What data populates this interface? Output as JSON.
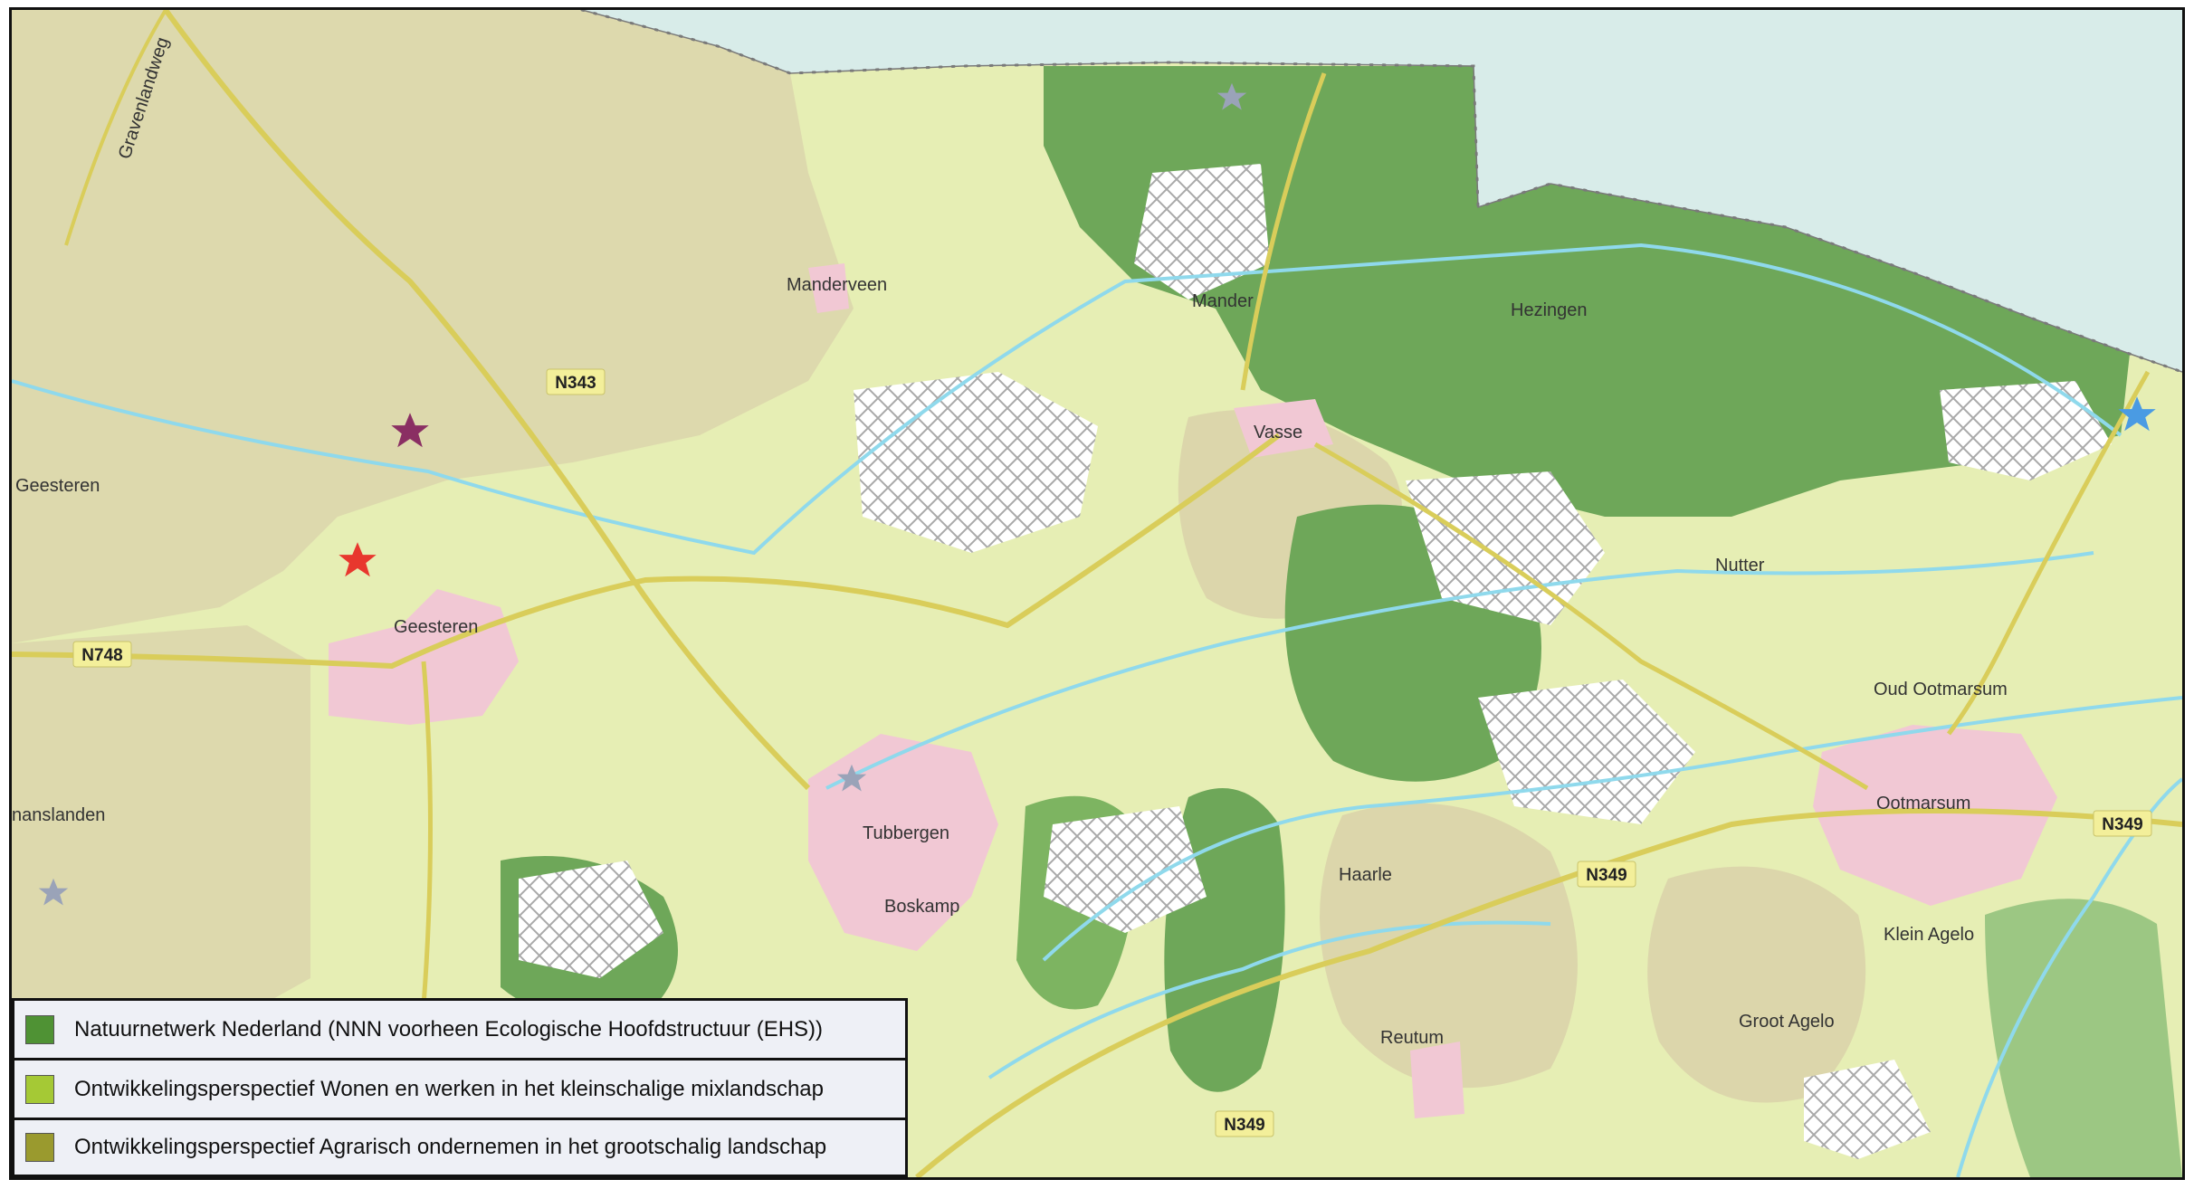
{
  "map": {
    "colors": {
      "water": "#d8ece9",
      "mix_landscape": "#e6eeb4",
      "agrarian": "#ddd9ad",
      "nature": "#6ea759",
      "built_up": "#f1c8d4",
      "stream": "#8fd9ec",
      "road": "#d9cd5a",
      "border": "#7a7a7a"
    },
    "places": [
      {
        "name": "Manderveen"
      },
      {
        "name": "Mander"
      },
      {
        "name": "Hezingen"
      },
      {
        "name": "Geesteren"
      },
      {
        "name": "Geesteren"
      },
      {
        "name": "Vasse"
      },
      {
        "name": "Nutter"
      },
      {
        "name": "Oud Ootmarsum"
      },
      {
        "name": "Ootmarsum"
      },
      {
        "name": "Tubbergen"
      },
      {
        "name": "Boskamp"
      },
      {
        "name": "Haarle"
      },
      {
        "name": "Klein Agelo"
      },
      {
        "name": "Groot Agelo"
      },
      {
        "name": "Reutum"
      },
      {
        "name": "nanslanden"
      },
      {
        "name": "Gravenlandweg"
      }
    ],
    "roads": [
      {
        "label": "N343"
      },
      {
        "label": "N748"
      },
      {
        "label": "N349"
      },
      {
        "label": "N349"
      },
      {
        "label": "N349"
      }
    ],
    "markers": [
      {
        "name": "purple-star",
        "color": "#8a2f63"
      },
      {
        "name": "red-star",
        "color": "#e8372e"
      },
      {
        "name": "blue-star",
        "color": "#4a9be3"
      }
    ]
  },
  "legend": [
    {
      "label": "Natuurnetwerk Nederland (NNN voorheen Ecologische Hoofdstructuur (EHS))",
      "color": "#4f9234"
    },
    {
      "label": "Ontwikkelingsperspectief Wonen en werken in het kleinschalige mixlandschap",
      "color": "#a5c935"
    },
    {
      "label": "Ontwikkelingsperspectief Agrarisch ondernemen in het grootschalig landschap",
      "color": "#9a9a2e"
    }
  ]
}
